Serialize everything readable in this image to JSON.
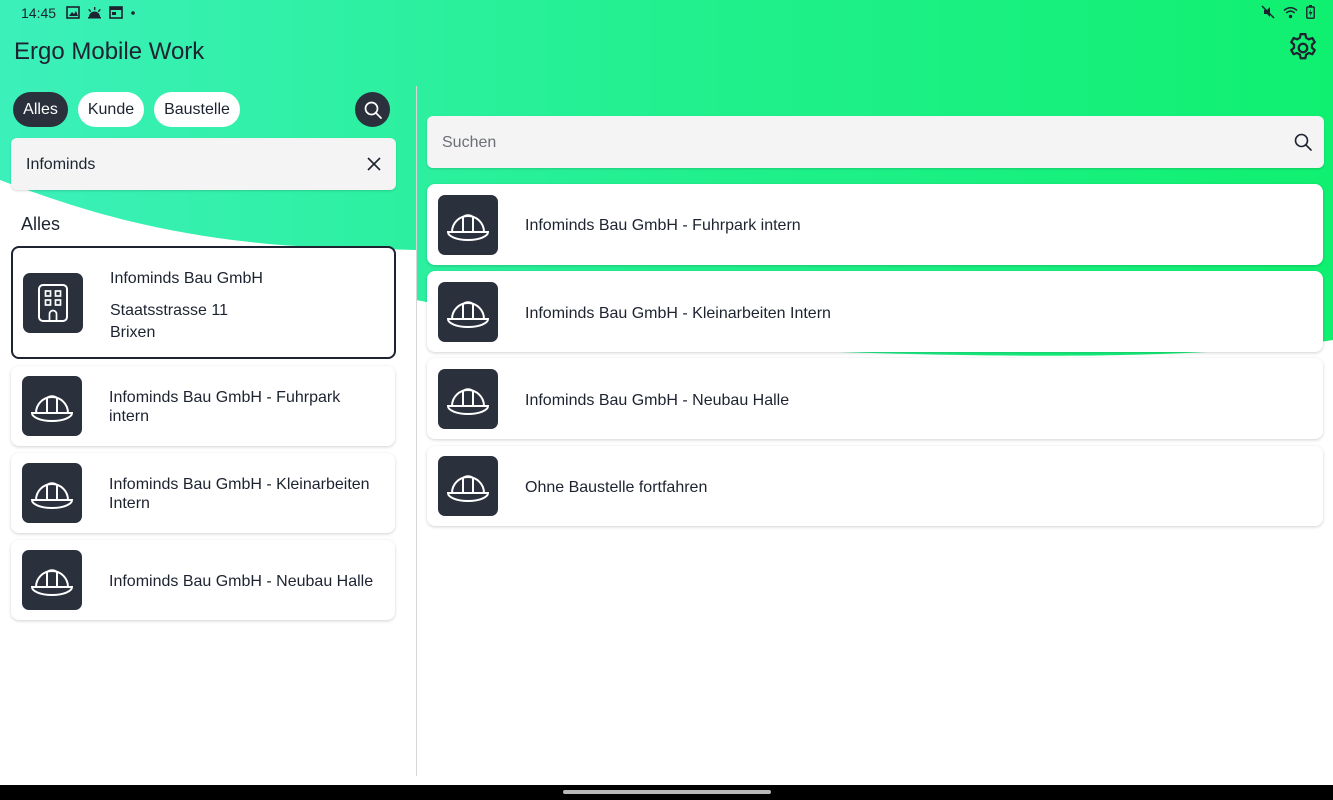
{
  "status_bar": {
    "time": "14:45"
  },
  "app": {
    "title": "Ergo Mobile Work"
  },
  "filters": {
    "chips": [
      {
        "label": "Alles",
        "active": true
      },
      {
        "label": "Kunde",
        "active": false
      },
      {
        "label": "Baustelle",
        "active": false
      }
    ]
  },
  "left_search": {
    "value": "Infominds"
  },
  "left_section": {
    "heading": "Alles"
  },
  "left_results": [
    {
      "icon": "building-icon",
      "title": "Infominds Bau GmbH",
      "address_line1": "Staatsstrasse 11",
      "address_line2": "Brixen",
      "selected": true
    },
    {
      "icon": "helmet-icon",
      "title": "Infominds Bau GmbH - Fuhrpark intern"
    },
    {
      "icon": "helmet-icon",
      "title": "Infominds Bau GmbH - Kleinarbeiten Intern"
    },
    {
      "icon": "helmet-icon",
      "title": "Infominds Bau GmbH - Neubau Halle"
    }
  ],
  "right_search": {
    "placeholder": "Suchen",
    "value": ""
  },
  "right_results": [
    {
      "icon": "helmet-icon",
      "title": "Infominds Bau GmbH - Fuhrpark intern"
    },
    {
      "icon": "helmet-icon",
      "title": "Infominds Bau GmbH - Kleinarbeiten Intern"
    },
    {
      "icon": "helmet-icon",
      "title": "Infominds Bau GmbH - Neubau Halle"
    },
    {
      "icon": "helmet-icon",
      "title": "Ohne Baustelle fortfahren"
    }
  ],
  "colors": {
    "accent_green": "#12f07a",
    "accent_light": "#33f0b0",
    "dark_tile": "#2a313d",
    "text": "#1d2330"
  }
}
